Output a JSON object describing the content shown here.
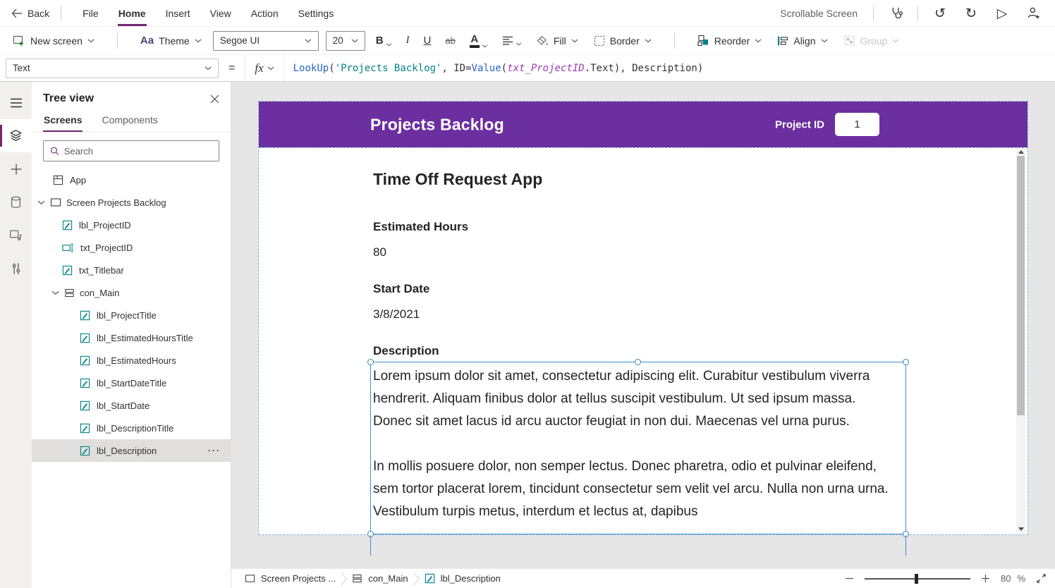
{
  "colors": {
    "accent": "#742774",
    "canvas_header": "#6b2fa0",
    "control_teal": "#038387",
    "selection_blue": "#3f90cc"
  },
  "menubar": {
    "back_label": "Back",
    "items": [
      "File",
      "Home",
      "Insert",
      "View",
      "Action",
      "Settings"
    ],
    "active_item": "Home",
    "right_label": "Scrollable Screen",
    "undo_glyph": "↺",
    "redo_glyph": "↻",
    "play_glyph": "▷"
  },
  "toolbar": {
    "new_screen": "New screen",
    "theme_icon": "Aa",
    "theme": "Theme",
    "font_name": "Segoe UI",
    "font_size": "20",
    "bold": "B",
    "italic": "I",
    "underline": "U",
    "strikethrough": "ab",
    "font_color": "A",
    "fill": "Fill",
    "border": "Border",
    "reorder": "Reorder",
    "align": "Align",
    "group": "Group"
  },
  "formula_bar": {
    "property": "Text",
    "equals": "=",
    "fx": "fx",
    "tokens": [
      {
        "text": "LookUp"
      },
      {
        "text": "("
      },
      {
        "text": "'Projects Backlog'"
      },
      {
        "text": ", ID="
      },
      {
        "text": "Value"
      },
      {
        "text": "("
      },
      {
        "text": "txt_ProjectID"
      },
      {
        "text": ".Text"
      },
      {
        "text": "), Description)"
      }
    ]
  },
  "tree_panel": {
    "title": "Tree view",
    "tabs": [
      "Screens",
      "Components"
    ],
    "search_placeholder": "Search",
    "app_label": "App",
    "screen_label": "Screen Projects Backlog",
    "ellipsis": "···",
    "items": [
      {
        "name": "lbl_ProjectID"
      },
      {
        "name": "txt_ProjectID"
      },
      {
        "name": "txt_Titlebar"
      },
      {
        "name": "con_Main"
      },
      {
        "name": "lbl_ProjectTitle"
      },
      {
        "name": "lbl_EstimatedHoursTitle"
      },
      {
        "name": "lbl_EstimatedHours"
      },
      {
        "name": "lbl_StartDateTitle"
      },
      {
        "name": "lbl_StartDate"
      },
      {
        "name": "lbl_DescriptionTitle"
      },
      {
        "name": "lbl_Description"
      }
    ]
  },
  "canvas": {
    "titlebar": {
      "title": "Projects Backlog",
      "project_id_label": "Project ID",
      "project_id_value": "1"
    },
    "content": {
      "title": "Time Off Request App",
      "fields": [
        {
          "label": "Estimated Hours",
          "value": "80"
        },
        {
          "label": "Start Date",
          "value": "3/8/2021"
        }
      ],
      "description_label": "Description",
      "description_paragraph1": "Lorem ipsum dolor sit amet, consectetur adipiscing elit. Curabitur vestibulum viverra hendrerit. Aliquam finibus dolor at tellus suscipit vestibulum. Ut sed ipsum massa. Donec sit amet lacus id arcu auctor feugiat in non dui. Maecenas vel urna purus.",
      "description_paragraph2": "In mollis posuere dolor, non semper lectus. Donec pharetra, odio et pulvinar eleifend, sem tortor placerat lorem, tincidunt consectetur sem velit vel arcu. Nulla non urna urna. Vestibulum turpis metus, interdum et lectus at, dapibus"
    }
  },
  "statusbar": {
    "breadcrumb": [
      "Screen Projects ...",
      "con_Main",
      "lbl_Description"
    ],
    "zoom_value": "80",
    "zoom_unit": "%"
  }
}
